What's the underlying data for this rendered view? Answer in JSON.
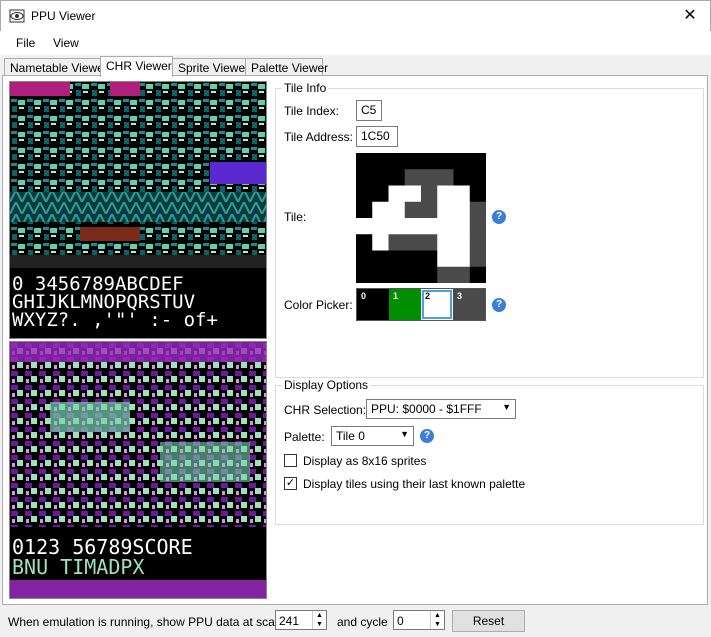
{
  "window": {
    "title": "PPU Viewer",
    "close_symbol": "✕"
  },
  "menu": [
    "File",
    "View"
  ],
  "tabs": [
    "Nametable Viewer",
    "CHR Viewer",
    "Sprite Viewer",
    "Palette Viewer"
  ],
  "chr_text": {
    "top_row1": "0 3456789ABCDEF",
    "top_row2": "GHIJKLMNOPQRSTUV",
    "top_row3": "WXYZ?. ,'\"' :- of+",
    "bottom_row1": "0123 56789SCORE",
    "bottom_row2": "BNU TIMADPX"
  },
  "tile_info": {
    "title": "Tile Info",
    "index_label": "Tile Index:",
    "index_value": "C5",
    "address_label": "Tile Address:",
    "address_value": "1C50",
    "tile_label": "Tile:",
    "color_picker_label": "Color Picker:",
    "swatches": [
      {
        "label": "0",
        "color": "#000000"
      },
      {
        "label": "1",
        "color": "#008f00"
      },
      {
        "label": "2",
        "color": "#ffffff"
      },
      {
        "label": "3",
        "color": "#4a4a4a"
      }
    ],
    "tile_pixels": [
      "00000000",
      "00033300",
      "00223220",
      "02233223",
      "22222223",
      "02333223",
      "00000223",
      "00000330"
    ]
  },
  "display_options": {
    "title": "Display Options",
    "chr_selection_label": "CHR Selection:",
    "chr_selection_value": "PPU: $0000 - $1FFF",
    "palette_label": "Palette:",
    "palette_value": "Tile 0",
    "cb1_label": "Display as 8x16 sprites",
    "cb1_checked": false,
    "cb2_label": "Display tiles using their last known palette",
    "cb2_checked": true
  },
  "bottom": {
    "scanline_label": "When emulation is running, show PPU data at scanline",
    "scanline_value": "241",
    "cycle_label": "and cycle",
    "cycle_value": "0",
    "reset_label": "Reset"
  }
}
